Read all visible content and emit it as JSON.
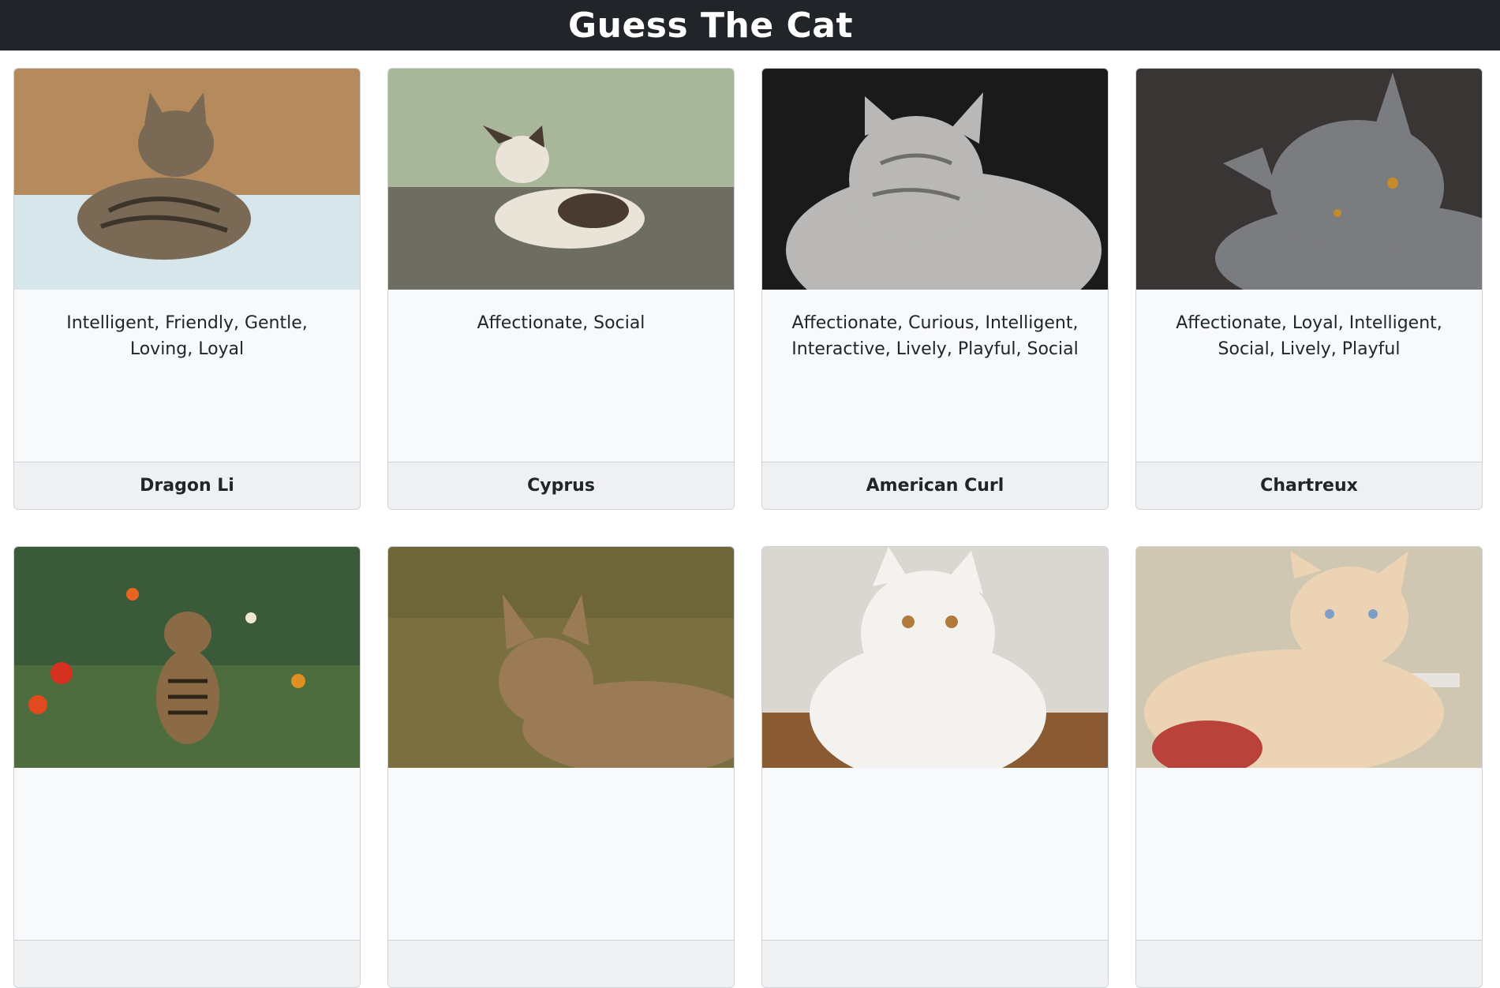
{
  "header": {
    "title": "Guess The Cat"
  },
  "cards": [
    {
      "traits": "Intelligent, Friendly, Gentle, Loving, Loyal",
      "breed": "Dragon Li",
      "image": "tabby-cat-photo",
      "colors": {
        "bg": "#b58a5c",
        "floor": "#d6e6ea",
        "cat": "#7a6a55",
        "stripe": "#3d342a"
      }
    },
    {
      "traits": "Affectionate, Social",
      "breed": "Cyprus",
      "image": "calico-cat-photo",
      "colors": {
        "bg": "#a8b79a",
        "floor": "#6e6d63",
        "cat": "#e9e3d8",
        "stripe": "#4a3b30"
      }
    },
    {
      "traits": "Affectionate, Curious, Intelligent, Interactive, Lively, Playful, Social",
      "breed": "American Curl",
      "image": "silver-fluffy-cat-photo",
      "colors": {
        "bg": "#1a1a1a",
        "floor": "#2a2a2a",
        "cat": "#b9b8b6",
        "stripe": "#6e6d6a"
      }
    },
    {
      "traits": "Affectionate, Loyal, Intelligent, Social, Lively, Playful",
      "breed": "Chartreux",
      "image": "gray-cat-photo",
      "colors": {
        "bg": "#3a3535",
        "floor": "#2a2626",
        "cat": "#7b7c80",
        "stripe": "#5c5d61"
      }
    },
    {
      "traits": "",
      "breed": "",
      "image": "bengal-kitten-in-flowers-photo",
      "colors": {
        "bg": "#3b5a3a",
        "floor": "#4d6d3e",
        "cat": "#8a6b45",
        "stripe": "#2f2418"
      }
    },
    {
      "traits": "",
      "breed": "",
      "image": "brown-cat-in-grass-photo",
      "colors": {
        "bg": "#6e6538",
        "floor": "#7a703f",
        "cat": "#9b7a56",
        "stripe": "#5d4630"
      }
    },
    {
      "traits": "",
      "breed": "",
      "image": "white-persian-cat-photo",
      "colors": {
        "bg": "#d9d7d0",
        "floor": "#8a5a33",
        "cat": "#f4f2ee",
        "stripe": "#d8d4cc"
      }
    },
    {
      "traits": "",
      "breed": "",
      "image": "cream-cat-photo",
      "colors": {
        "bg": "#cfc7b2",
        "floor": "#e7e4df",
        "cat": "#ecd3b4",
        "stripe": "#d8b68f"
      }
    }
  ]
}
